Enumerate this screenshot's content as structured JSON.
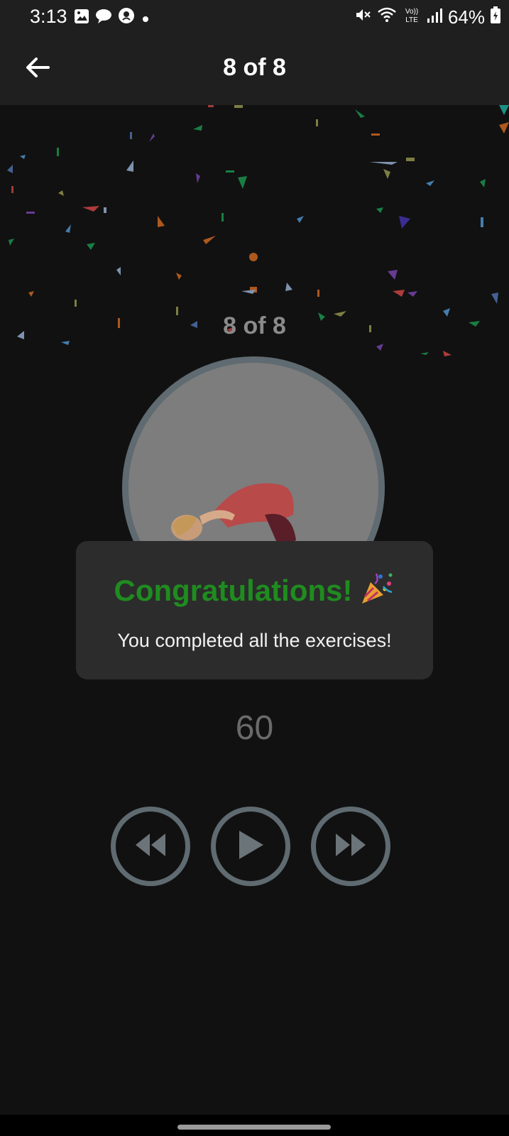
{
  "status_bar": {
    "time": "3:13",
    "battery": "64%",
    "icons_left": [
      "gallery-icon",
      "chat-icon",
      "location-icon",
      "dot-icon"
    ],
    "icons_right": [
      "mute-icon",
      "wifi-icon",
      "volte-icon",
      "signal-icon",
      "battery-icon"
    ],
    "volte_label": "Vo)) LTE"
  },
  "app_bar": {
    "back_icon": "back-arrow-icon",
    "title": "8 of 8"
  },
  "exercise": {
    "counter": "8 of 8",
    "timer": "60",
    "image": "person-forward-bend-pose"
  },
  "controls": {
    "rewind_icon": "rewind-icon",
    "play_icon": "play-icon",
    "forward_icon": "fast-forward-icon"
  },
  "dialog": {
    "title": "Congratulations!",
    "emoji": "🎉",
    "message": "You completed all the exercises!"
  },
  "colors": {
    "background": "#111111",
    "app_bar": "#1f1f1f",
    "dialog": "#2c2c2c",
    "congrats_green": "#1f8c1f",
    "circle_border": "#5f6b71"
  }
}
